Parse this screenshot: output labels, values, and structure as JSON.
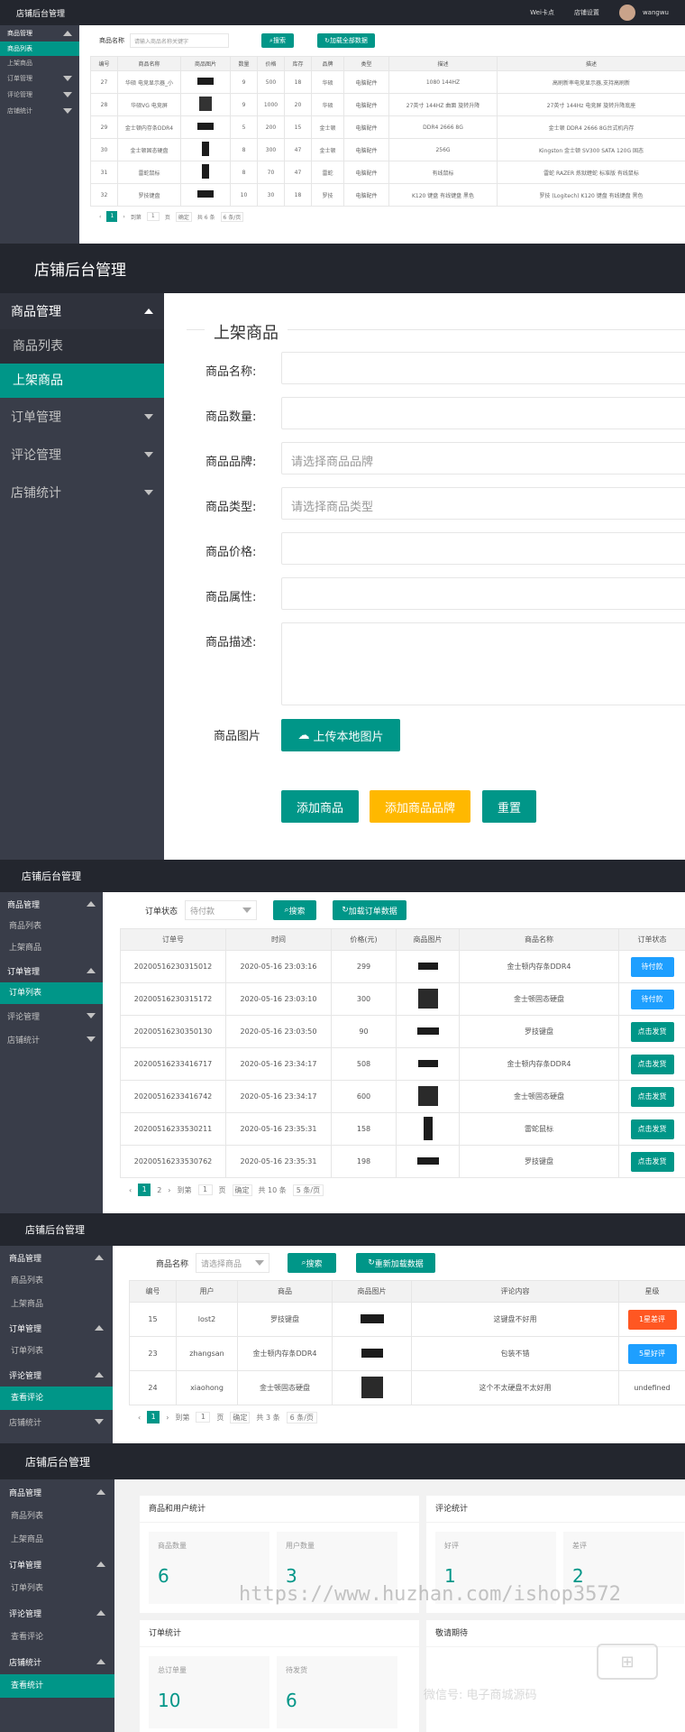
{
  "p1": {
    "title": "店铺后台管理",
    "topnav": [
      "Wei卡点",
      "店铺设置"
    ],
    "username": "wangwu",
    "menu": [
      "商品管理",
      "商品列表",
      "上架商品",
      "订单管理",
      "评论管理",
      "店铺统计"
    ],
    "filter_label": "商品名称",
    "filter_placeholder": "请输入商品名称关键字",
    "search": "搜索",
    "reload": "加载全部数据",
    "columns": [
      "编号",
      "商品名称",
      "商品图片",
      "数量",
      "价格",
      "库存",
      "品牌",
      "类型",
      "描述",
      "描述"
    ],
    "rows": [
      [
        "27",
        "华硕 电竞显示器_小",
        "",
        "9",
        "500",
        "18",
        "华硕",
        "电脑配件",
        "1080 144HZ",
        "高刷新率电竞显示器,支持高刷新"
      ],
      [
        "28",
        "华硕VG 电竞屏",
        "",
        "9",
        "1000",
        "20",
        "华硕",
        "电脑配件",
        "27英寸 144HZ 曲面 旋转升降",
        "27英寸 144Hz 电竞屏 旋转升降底座"
      ],
      [
        "29",
        "金士顿内存条DDR4",
        "",
        "5",
        "200",
        "15",
        "金士顿",
        "电脑配件",
        "DDR4 2666 8G",
        "金士顿 DDR4 2666 8G台式机内存"
      ],
      [
        "30",
        "金士顿固态硬盘",
        "",
        "8",
        "300",
        "47",
        "金士顿",
        "电脑配件",
        "256G",
        "Kingston 金士顿 SV300 SATA 120G 固态"
      ],
      [
        "31",
        "雷蛇鼠标",
        "",
        "8",
        "70",
        "47",
        "雷蛇",
        "电脑配件",
        "有线鼠标",
        "雷蛇 RAZER 炼狱蝰蛇 标准版 有线鼠标"
      ],
      [
        "32",
        "罗技键盘",
        "",
        "10",
        "30",
        "18",
        "罗技",
        "电脑配件",
        "K120 键盘 有线键盘 黑色",
        "罗技 (Logitech) K120 键盘 有线键盘 黑色"
      ]
    ],
    "page": "1",
    "goto": "到第",
    "page_unit": "页",
    "confirm": "确定",
    "total": "共 6 条",
    "perpage": "6 条/页"
  },
  "p2": {
    "title": "店铺后台管理",
    "menu": [
      "商品管理",
      "商品列表",
      "上架商品",
      "订单管理",
      "评论管理",
      "店铺统计"
    ],
    "section": "上架商品",
    "labels": [
      "商品名称:",
      "商品数量:",
      "商品品牌:",
      "商品类型:",
      "商品价格:",
      "商品属性:",
      "商品描述:"
    ],
    "brand_placeholder": "请选择商品品牌",
    "type_placeholder": "请选择商品类型",
    "image_label": "商品图片",
    "upload": "上传本地图片",
    "add": "添加商品",
    "add_brand": "添加商品品牌",
    "reset": "重置"
  },
  "p3": {
    "title": "店铺后台管理",
    "menu": [
      "商品管理",
      "商品列表",
      "上架商品",
      "订单管理",
      "订单列表",
      "评论管理",
      "店铺统计"
    ],
    "filter_label": "订单状态",
    "filter_value": "待付款",
    "search": "搜索",
    "reload": "加载订单数据",
    "columns": [
      "订单号",
      "时间",
      "价格(元)",
      "商品图片",
      "商品名称",
      "订单状态"
    ],
    "rows": [
      [
        "20200516230315012",
        "2020-05-16 23:03:16",
        "299",
        "金士顿内存条DDR4",
        "待付款"
      ],
      [
        "20200516230315172",
        "2020-05-16 23:03:10",
        "300",
        "金士顿固态硬盘",
        "待付款"
      ],
      [
        "20200516230350130",
        "2020-05-16 23:03:50",
        "90",
        "罗技键盘",
        "点击发货"
      ],
      [
        "20200516233416717",
        "2020-05-16 23:34:17",
        "508",
        "金士顿内存条DDR4",
        "点击发货"
      ],
      [
        "20200516233416742",
        "2020-05-16 23:34:17",
        "600",
        "金士顿固态硬盘",
        "点击发货"
      ],
      [
        "20200516233530211",
        "2020-05-16 23:35:31",
        "158",
        "雷蛇鼠标",
        "点击发货"
      ],
      [
        "20200516233530762",
        "2020-05-16 23:35:31",
        "198",
        "罗技键盘",
        "点击发货"
      ]
    ],
    "pages": [
      "1",
      "2"
    ],
    "goto": "到第",
    "goto_val": "1",
    "page_unit": "页",
    "confirm": "确定",
    "total": "共 10 条",
    "perpage": "5 条/页"
  },
  "p4": {
    "title": "店铺后台管理",
    "menu": [
      "商品管理",
      "商品列表",
      "上架商品",
      "订单管理",
      "订单列表",
      "评论管理",
      "查看评论",
      "店铺统计"
    ],
    "filter_label": "商品名称",
    "filter_placeholder": "请选择商品",
    "search": "搜索",
    "reload": "重新加载数据",
    "columns": [
      "编号",
      "用户",
      "商品",
      "商品图片",
      "评论内容",
      "星级"
    ],
    "rows": [
      [
        "15",
        "lost2",
        "罗技键盘",
        "这键盘不好用",
        "1星差评"
      ],
      [
        "23",
        "zhangsan",
        "金士顿内存条DDR4",
        "包装不错",
        "5星好评"
      ],
      [
        "24",
        "xiaohong",
        "金士顿固态硬盘",
        "这个不太硬盘不太好用",
        "undefined"
      ]
    ],
    "page": "1",
    "goto": "到第",
    "goto_val": "1",
    "page_unit": "页",
    "confirm": "确定",
    "total": "共 3 条",
    "perpage": "6 条/页"
  },
  "p5": {
    "title": "店铺后台管理",
    "menu": [
      "商品管理",
      "商品列表",
      "上架商品",
      "订单管理",
      "订单列表",
      "评论管理",
      "查看评论",
      "店铺统计",
      "查看统计"
    ],
    "cards": [
      {
        "title": "商品和用户统计",
        "items": [
          {
            "label": "商品数量",
            "value": "6"
          },
          {
            "label": "用户数量",
            "value": "3"
          }
        ]
      },
      {
        "title": "评论统计",
        "items": [
          {
            "label": "好评",
            "value": "1"
          },
          {
            "label": "差评",
            "value": "2"
          }
        ]
      },
      {
        "title": "订单统计",
        "items": [
          {
            "label": "总订单量",
            "value": "10"
          },
          {
            "label": "待发货",
            "value": "6"
          }
        ]
      },
      {
        "title": "敬请期待",
        "items": []
      }
    ],
    "watermark": "https://www.huzhan.com/ishop3572",
    "watermark2": "微信号: 电子商城源码"
  },
  "colors": {
    "accent": "#009688",
    "orange": "#ffb800",
    "danger": "#ff5722",
    "blue": "#1e9fff",
    "sidebar": "#393d49",
    "topbar": "#23262e"
  }
}
